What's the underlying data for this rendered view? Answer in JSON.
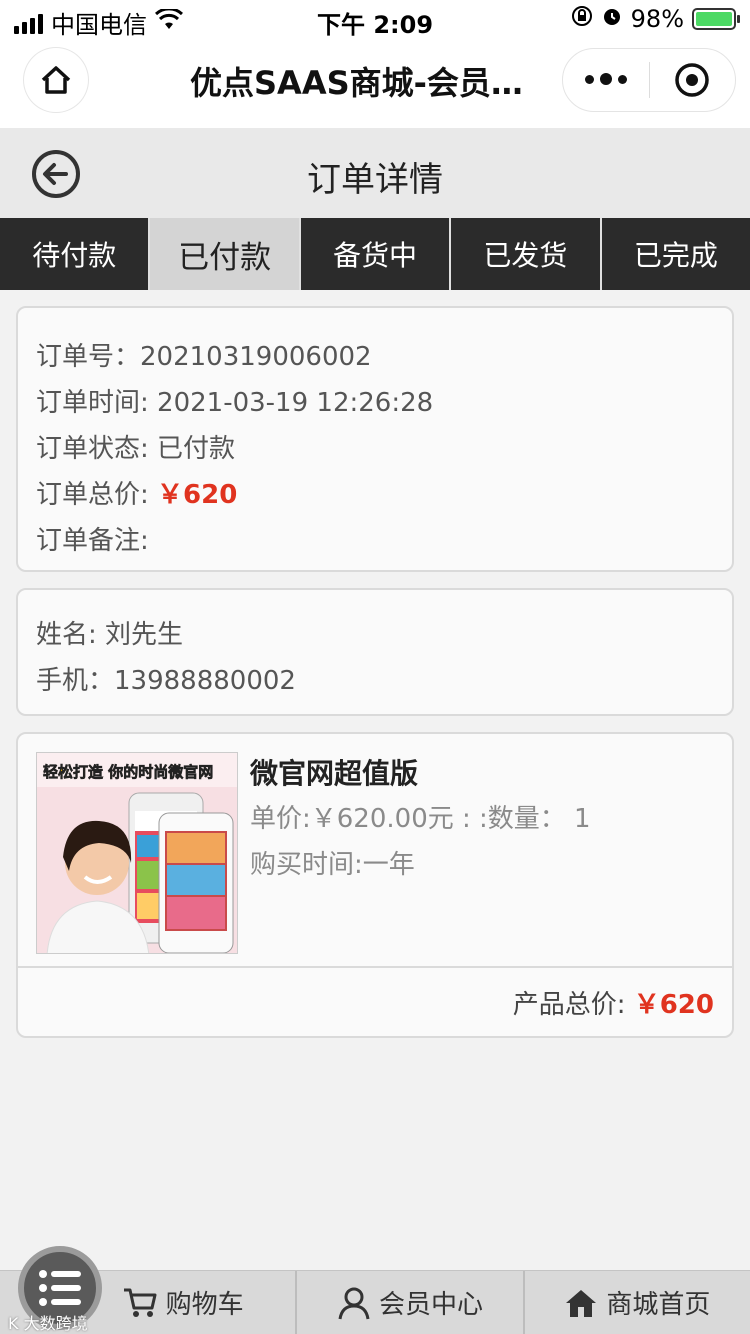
{
  "status_bar": {
    "carrier": "中国电信",
    "time": "下午 2:09",
    "battery": "98%",
    "battery_color": "#4cd964"
  },
  "mp_nav": {
    "title": "优点SAAS商城-会员…",
    "home_icon": "home-icon",
    "more_icon": "more-dots-icon",
    "close_icon": "target-circle-icon"
  },
  "header": {
    "title": "订单详情",
    "back_icon": "back-arrow-icon"
  },
  "tabs": [
    {
      "label": "待付款",
      "active": false
    },
    {
      "label": "已付款",
      "active": true
    },
    {
      "label": "备货中",
      "active": false
    },
    {
      "label": "已发货",
      "active": false
    },
    {
      "label": "已完成",
      "active": false
    }
  ],
  "order": {
    "number_label": "订单号：",
    "number": "20210319006002",
    "time_label": "订单时间: ",
    "time": "2021-03-19 12:26:28",
    "status_label": "订单状态: ",
    "status": "已付款",
    "total_label": "订单总价: ",
    "total": "￥620",
    "remark_label": "订单备注: ",
    "remark": ""
  },
  "contact": {
    "name_label": "姓名: ",
    "name": "刘先生",
    "phone_label": "手机：",
    "phone": "13988880002"
  },
  "product": {
    "image_caption": "轻松打造 你的时尚微官网",
    "name": "微官网超值版",
    "price_line": "单价:￥620.00元 : :数量： 1",
    "period_line": "购买时间:一年",
    "total_label": "产品总价: ",
    "total": "￥620"
  },
  "bottom_bar": {
    "items": [
      {
        "label": "购物车",
        "icon": "cart-icon"
      },
      {
        "label": "会员中心",
        "icon": "user-icon"
      },
      {
        "label": "商城首页",
        "icon": "house-icon"
      }
    ],
    "menu_icon": "menu-list-icon",
    "watermark": "K 大数跨境"
  },
  "colors": {
    "accent_red": "#e0331f",
    "tab_dark": "#2b2b2b",
    "tab_active": "#d4d4d4"
  }
}
